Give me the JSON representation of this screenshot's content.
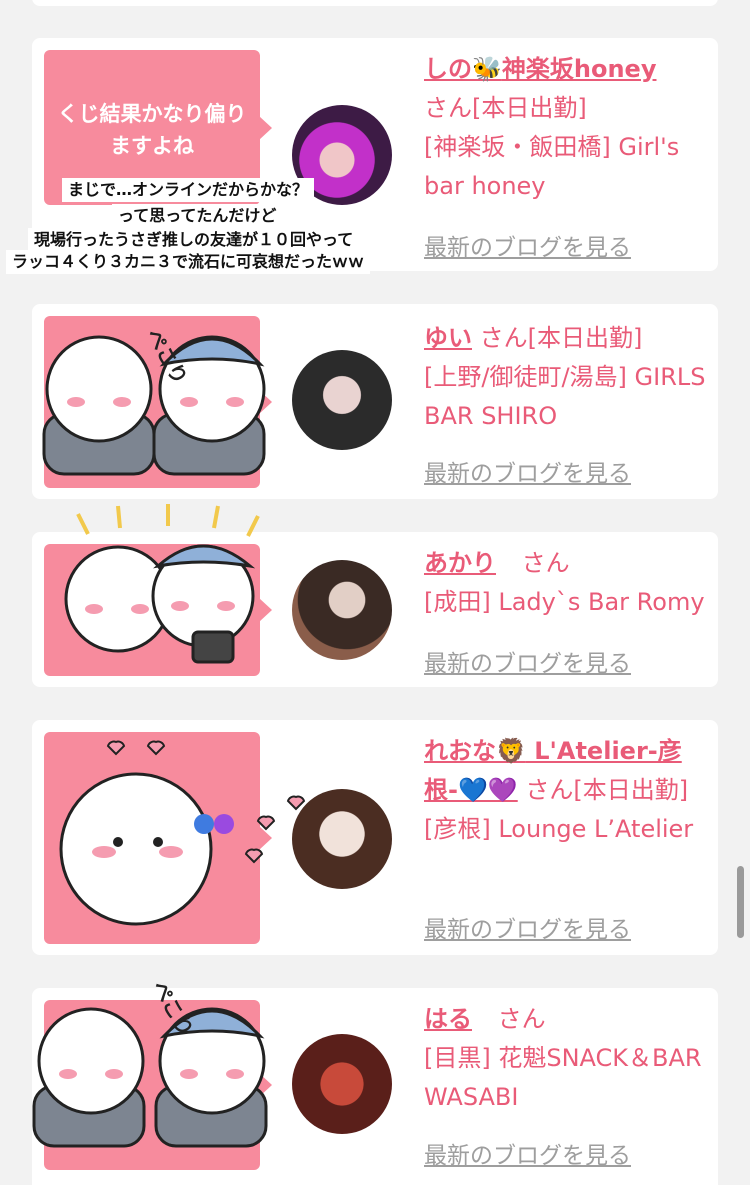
{
  "cards": [
    {
      "name_prefix": "しの",
      "name_emoji": "🐝",
      "name_suffix": "神楽坂honey",
      "san": "さん[本日出勤]",
      "shop": "[神楽坂・飯田橋] Girl's bar honey",
      "blog": "最新のブログを見る",
      "bubble": "くじ結果かなり偏りますよね"
    },
    {
      "name": "ゆい",
      "san": "さん[本日出勤]",
      "shop": "[上野/御徒町/湯島] GIRLS BAR SHIRO",
      "blog": "最新のブログを見る",
      "sticker_text": "ぺこり"
    },
    {
      "name": "あかり",
      "san": "さん",
      "shop": "[成田] Lady`s Bar Romy",
      "blog": "最新のブログを見る"
    },
    {
      "name_prefix": "れおな",
      "name_emoji": "🦁",
      "name_suffix": " L'Atelier-彦根-💙💜",
      "san": "さん[本日出勤]",
      "shop": "[彦根] Lounge L’Atelier",
      "blog": "最新のブログを見る"
    },
    {
      "name": "はる",
      "san": "さん",
      "shop": "[目黒] 花魁SNACK＆BAR WASABI",
      "blog": "最新のブログを見る",
      "sticker_text": "ぺこり"
    }
  ],
  "caption_lines": [
    "まじで…オンラインだからかな？",
    "って思ってたんだけど",
    "現場行ったうさぎ推しの友達が１０回やって",
    "ラッコ４くり３カニ３で流石に可哀想だったｗｗ"
  ],
  "colors": {
    "pink": "#e95b78",
    "bubble": "#f78b9d",
    "gray": "#9e9e9e",
    "background": "#f2f2f2"
  }
}
